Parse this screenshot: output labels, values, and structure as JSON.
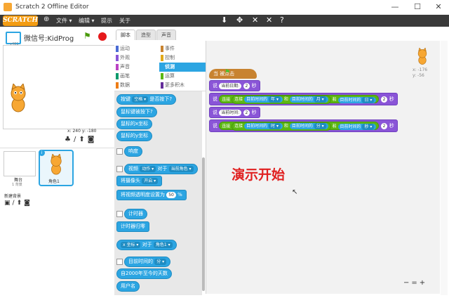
{
  "window": {
    "title": "Scratch 2 Offline Editor",
    "minimize": "—",
    "maximize": "☐",
    "close": "✕"
  },
  "menu": {
    "logo": "SCRATCH",
    "globe_icon": "globe-icon",
    "items": [
      "文件 ▾",
      "编辑 ▾",
      "提示",
      "关于"
    ],
    "tools": [
      "⬇",
      "✥",
      "✕",
      "✕",
      "?"
    ]
  },
  "stage": {
    "name": "微信号:KidProg",
    "version_label": "v461",
    "coords": "x: 240  y: -180"
  },
  "sprites": {
    "stage_label": "舞台",
    "stage_sub": "1 背景",
    "new_backdrop": "新建背景",
    "sprite_name": "角色1"
  },
  "tabs": [
    "脚本",
    "造型",
    "声音"
  ],
  "categories": {
    "left": [
      {
        "label": "运动",
        "color": "#4a6cd4"
      },
      {
        "label": "外观",
        "color": "#8a55d7"
      },
      {
        "label": "声音",
        "color": "#bb42c3"
      },
      {
        "label": "画笔",
        "color": "#0e9a6c"
      },
      {
        "label": "数据",
        "color": "#ee7d16"
      }
    ],
    "right": [
      {
        "label": "事件",
        "color": "#c88330"
      },
      {
        "label": "控制",
        "color": "#e1a91a"
      },
      {
        "label": "侦测",
        "color": "#2ca5e2",
        "selected": true
      },
      {
        "label": "运算",
        "color": "#5cb712"
      },
      {
        "label": "更多积木",
        "color": "#632d99"
      }
    ]
  },
  "palette": {
    "key_pressed_pre": "按键",
    "key_pressed_dd": "空格 ▾",
    "key_pressed_post": "是否按下?",
    "mouse_down": "鼠标键被按下?",
    "mouse_x": "鼠标的x坐标",
    "mouse_y": "鼠标的y坐标",
    "loudness": "响度",
    "video_pre": "视频",
    "video_dd1": "动作 ▾",
    "video_mid": "对于",
    "video_dd2": "当前角色 ▾",
    "camera_pre": "将摄像头",
    "camera_dd": "开启 ▾",
    "transparency_pre": "将视频透明度设置为",
    "transparency_val": "50",
    "transparency_post": "%",
    "timer": "计时器",
    "reset_timer": "计时器归零",
    "of_dd1": "x 坐标 ▾",
    "of_mid": "对于",
    "of_dd2": "角色1 ▾",
    "current_pre": "目前时间的",
    "current_dd": "分 ▾",
    "days_since": "自2000年至今的天数",
    "username": "用户名"
  },
  "script": {
    "hat": "当    被点击",
    "flag_icon": "green-flag-icon",
    "say": "说",
    "secs": "秒",
    "two": "2",
    "join": "连接",
    "current_time": "目前时间的",
    "and": "和",
    "line1_text": "当前日期:",
    "line2_text": "当前时间:",
    "dd_year": "年 ▾",
    "dd_month": "月 ▾",
    "dd_day": "日 ▾",
    "dd_hour": "时 ▾",
    "dd_minute": "分 ▾",
    "dd_second": "秒 ▾"
  },
  "sprite_info": {
    "x": "x: -176",
    "y": "y: -56"
  },
  "overlay": {
    "demo_text": "演示开始"
  },
  "zoom": {
    "out": "−",
    "reset": "=",
    "in": "+"
  }
}
